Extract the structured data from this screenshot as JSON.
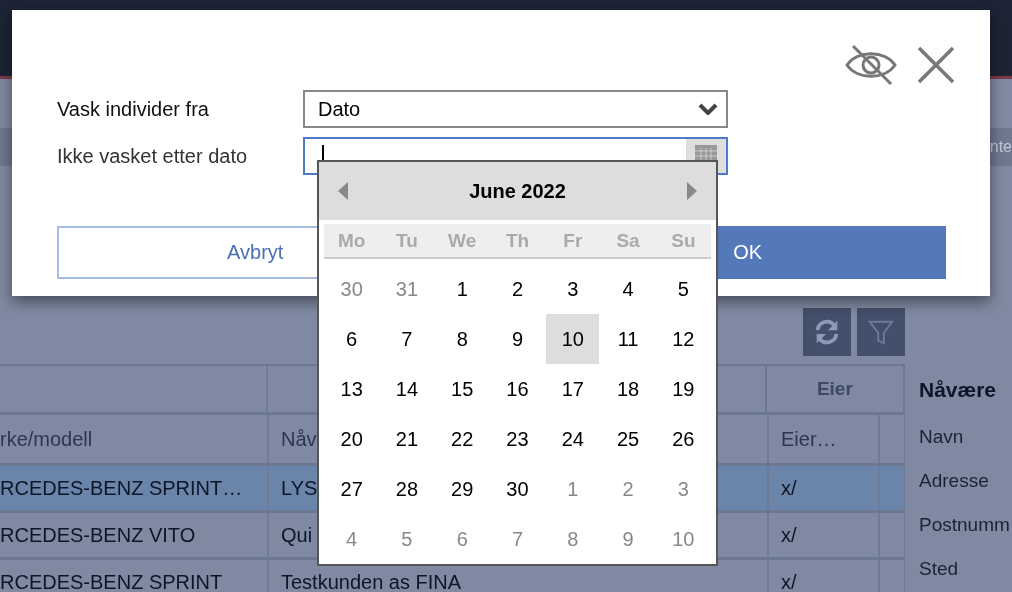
{
  "background": {
    "tab_strip_text": "nte",
    "toolbar": [
      {
        "kind": "refresh",
        "disabled": false
      },
      {
        "kind": "filter",
        "disabled": true
      }
    ],
    "table": {
      "group_header": "Eier",
      "columns": [
        "rke/modell",
        "Nåv",
        "Eier…"
      ],
      "rows": [
        {
          "selected": true,
          "cells": [
            "RCEDES-BENZ SPRINT…",
            "LYS",
            "x/"
          ]
        },
        {
          "selected": false,
          "cells": [
            "RCEDES-BENZ VITO",
            "Qui",
            "x/"
          ]
        },
        {
          "selected": false,
          "cells": [
            "RCEDES-BENZ SPRINT",
            "Testkunden as FINA",
            "x/"
          ]
        }
      ]
    },
    "side_panel": {
      "title": "Nåvære",
      "labels": [
        "Navn",
        "Adresse",
        "Postnumm",
        "Sted"
      ]
    }
  },
  "dialog": {
    "fields": [
      {
        "label": "Vask individer fra",
        "kind": "select",
        "value": "Dato",
        "focused": false
      },
      {
        "label": "Ikke vasket etter dato",
        "kind": "date",
        "focused": true
      }
    ],
    "buttons": [
      {
        "label": "Avbryt",
        "kind": "secondary"
      },
      {
        "label": "OK",
        "kind": "primary"
      }
    ]
  },
  "calendar": {
    "title": "June 2022",
    "weekdays": [
      "Mo",
      "Tu",
      "We",
      "Th",
      "Fr",
      "Sa",
      "Su"
    ],
    "weeks": [
      [
        {
          "day": "30",
          "outside": true,
          "selected": false
        },
        {
          "day": "31",
          "outside": true,
          "selected": false
        },
        {
          "day": "1",
          "outside": false,
          "selected": false
        },
        {
          "day": "2",
          "outside": false,
          "selected": false
        },
        {
          "day": "3",
          "outside": false,
          "selected": false
        },
        {
          "day": "4",
          "outside": false,
          "selected": false
        },
        {
          "day": "5",
          "outside": false,
          "selected": false
        }
      ],
      [
        {
          "day": "6",
          "outside": false,
          "selected": false
        },
        {
          "day": "7",
          "outside": false,
          "selected": false
        },
        {
          "day": "8",
          "outside": false,
          "selected": false
        },
        {
          "day": "9",
          "outside": false,
          "selected": false
        },
        {
          "day": "10",
          "outside": false,
          "selected": true
        },
        {
          "day": "11",
          "outside": false,
          "selected": false
        },
        {
          "day": "12",
          "outside": false,
          "selected": false
        }
      ],
      [
        {
          "day": "13",
          "outside": false,
          "selected": false
        },
        {
          "day": "14",
          "outside": false,
          "selected": false
        },
        {
          "day": "15",
          "outside": false,
          "selected": false
        },
        {
          "day": "16",
          "outside": false,
          "selected": false
        },
        {
          "day": "17",
          "outside": false,
          "selected": false
        },
        {
          "day": "18",
          "outside": false,
          "selected": false
        },
        {
          "day": "19",
          "outside": false,
          "selected": false
        }
      ],
      [
        {
          "day": "20",
          "outside": false,
          "selected": false
        },
        {
          "day": "21",
          "outside": false,
          "selected": false
        },
        {
          "day": "22",
          "outside": false,
          "selected": false
        },
        {
          "day": "23",
          "outside": false,
          "selected": false
        },
        {
          "day": "24",
          "outside": false,
          "selected": false
        },
        {
          "day": "25",
          "outside": false,
          "selected": false
        },
        {
          "day": "26",
          "outside": false,
          "selected": false
        }
      ],
      [
        {
          "day": "27",
          "outside": false,
          "selected": false
        },
        {
          "day": "28",
          "outside": false,
          "selected": false
        },
        {
          "day": "29",
          "outside": false,
          "selected": false
        },
        {
          "day": "30",
          "outside": false,
          "selected": false
        },
        {
          "day": "1",
          "outside": true,
          "selected": false
        },
        {
          "day": "2",
          "outside": true,
          "selected": false
        },
        {
          "day": "3",
          "outside": true,
          "selected": false
        }
      ],
      [
        {
          "day": "4",
          "outside": true,
          "selected": false
        },
        {
          "day": "5",
          "outside": true,
          "selected": false
        },
        {
          "day": "6",
          "outside": true,
          "selected": false
        },
        {
          "day": "7",
          "outside": true,
          "selected": false
        },
        {
          "day": "8",
          "outside": true,
          "selected": false
        },
        {
          "day": "9",
          "outside": true,
          "selected": false
        },
        {
          "day": "10",
          "outside": true,
          "selected": false
        }
      ]
    ]
  }
}
